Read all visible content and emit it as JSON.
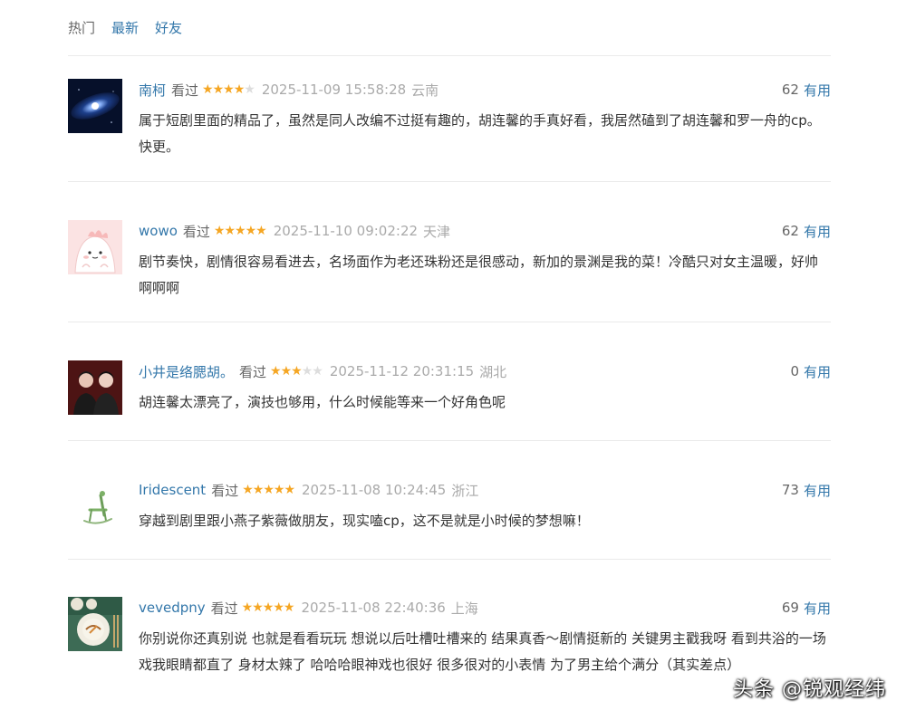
{
  "tabs": [
    {
      "label": "热门",
      "active": true
    },
    {
      "label": "最新",
      "active": false
    },
    {
      "label": "好友",
      "active": false
    }
  ],
  "watched_label": "看过",
  "useful_label": "有用",
  "colors": {
    "link": "#3377aa",
    "star": "#f5a623",
    "meta_gray": "#aaaaaa",
    "text": "#333333"
  },
  "comments": [
    {
      "user": "南柯",
      "rating": 4,
      "time": "2025-11-09 15:58:28",
      "location": "云南",
      "useful_count": "62",
      "text": "属于短剧里面的精品了，虽然是同人改编不过挺有趣的，胡连馨的手真好看，我居然磕到了胡连馨和罗一舟的cp。快更。",
      "avatar_icon": "galaxy-avatar-icon"
    },
    {
      "user": "wowo",
      "rating": 5,
      "time": "2025-11-10 09:02:22",
      "location": "天津",
      "useful_count": "62",
      "text": "剧节奏快，剧情很容易看进去，名场面作为老还珠粉还是很感动，新加的景渊是我的菜！冷酷只对女主温暖，好帅啊啊啊",
      "avatar_icon": "cartoon-dino-avatar-icon"
    },
    {
      "user": "小井是络腮胡。",
      "rating": 3,
      "time": "2025-11-12 20:31:15",
      "location": "湖北",
      "useful_count": "0",
      "text": "胡连馨太漂亮了，演技也够用，什么时候能等来一个好角色呢",
      "avatar_icon": "two-people-avatar-icon"
    },
    {
      "user": "Iridescent",
      "rating": 5,
      "time": "2025-11-08 10:24:45",
      "location": "浙江",
      "useful_count": "73",
      "text": "穿越到剧里跟小燕子紫薇做朋友，现实嗑cp，这不是就是小时候的梦想嘛！",
      "avatar_icon": "rocking-chair-avatar-icon"
    },
    {
      "user": "vevedpny",
      "rating": 5,
      "time": "2025-11-08 22:40:36",
      "location": "上海",
      "useful_count": "69",
      "text": "你别说你还真别说 也就是看看玩玩 想说以后吐槽吐槽来的 结果真香～剧情挺新的 关键男主戳我呀 看到共浴的一场戏我眼睛都直了 身材太辣了 哈哈哈眼神戏也很好 很多很对的小表情 为了男主给个满分（其实差点）",
      "avatar_icon": "dish-avatar-icon"
    }
  ],
  "watermark": "头条 @锐观经纬"
}
